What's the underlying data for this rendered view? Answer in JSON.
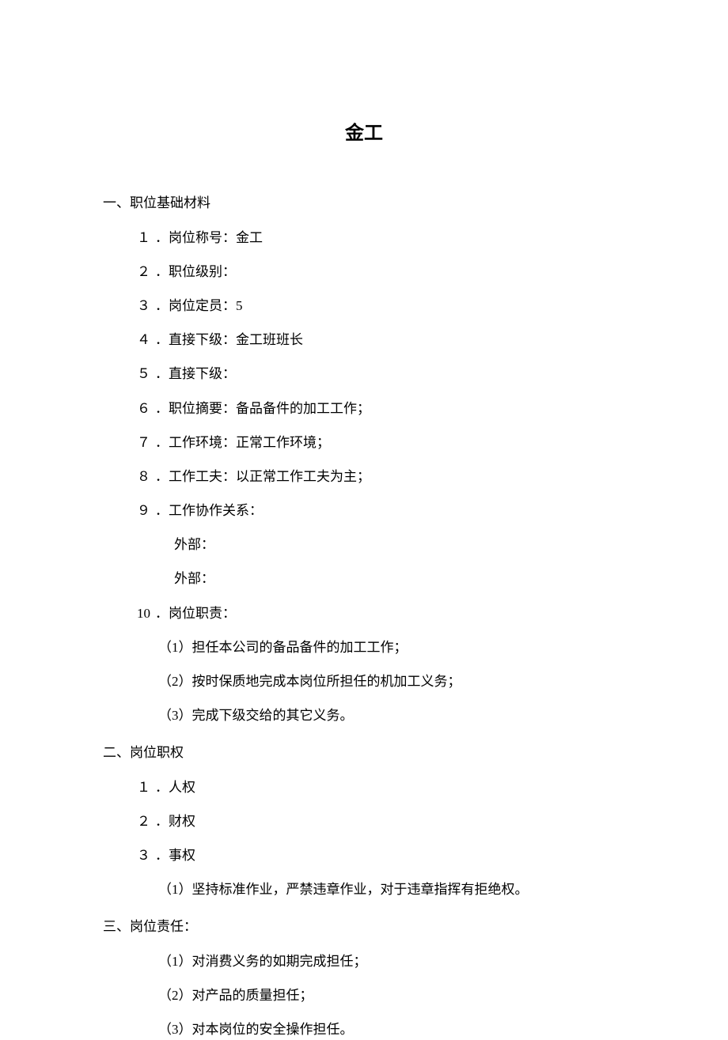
{
  "title": "金工",
  "section1": {
    "header": "一、职位基础材料",
    "items": [
      {
        "num": "１",
        "text": "．岗位称号：金工"
      },
      {
        "num": "２",
        "text": "．职位级别："
      },
      {
        "num": "３",
        "text": "．岗位定员：5"
      },
      {
        "num": "４",
        "text": "．直接下级：金工班班长"
      },
      {
        "num": "５",
        "text": "．直接下级："
      },
      {
        "num": "６",
        "text": "．职位摘要：备品备件的加工工作；"
      },
      {
        "num": "７",
        "text": "．工作环境：正常工作环境；"
      },
      {
        "num": "８",
        "text": "．工作工夫：以正常工作工夫为主；"
      },
      {
        "num": "９",
        "text": "．工作协作关系："
      }
    ],
    "item9_sub": [
      "外部：",
      "外部："
    ],
    "item10": {
      "num": "10",
      "text": "．岗位职责："
    },
    "item10_sub": [
      "（1）担任本公司的备品备件的加工工作；",
      "（2）按时保质地完成本岗位所担任的机加工义务；",
      "（3）完成下级交给的其它义务。"
    ]
  },
  "section2": {
    "header": "二、岗位职权",
    "items": [
      {
        "num": "１",
        "text": "．人权"
      },
      {
        "num": "２",
        "text": "．财权"
      },
      {
        "num": "３",
        "text": "．事权"
      }
    ],
    "item3_sub": [
      "（1）坚持标准作业，严禁违章作业，对于违章指挥有拒绝权。"
    ]
  },
  "section3": {
    "header": "三、岗位责任：",
    "items": [
      "（1）对消费义务的如期完成担任；",
      "（2）对产品的质量担任；",
      "（3）对本岗位的安全操作担任。"
    ]
  }
}
